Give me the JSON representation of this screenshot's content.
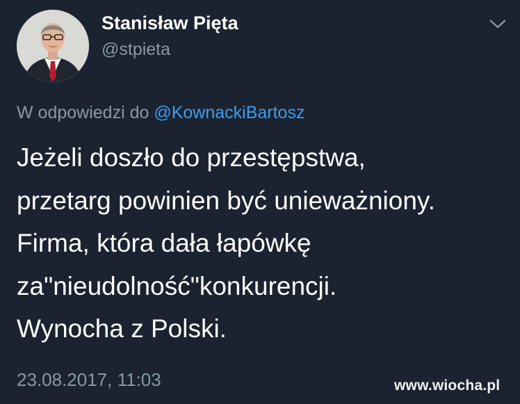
{
  "author": {
    "display_name": "Stanisław Pięta",
    "handle": "@stpieta",
    "avatar_icon": "profile-photo"
  },
  "menu": {
    "icon": "chevron-down-icon"
  },
  "reply_context": {
    "prefix": "W odpowiedzi do ",
    "mention": "@KownackiBartosz"
  },
  "tweet": {
    "lines": [
      "Jeżeli doszło do przestępstwa,",
      "przetarg powinien być unieważniony.",
      "Firma, która dała łapówkę",
      "za\"nieudolność\"konkurencji.",
      "Wynocha z Polski."
    ],
    "timestamp": "23.08.2017, 11:03"
  },
  "watermark": "www.wiocha.pl",
  "colors": {
    "background": "#1b2330",
    "text_primary": "#ffffff",
    "text_secondary": "#8899a6",
    "link": "#3b9ef0"
  }
}
